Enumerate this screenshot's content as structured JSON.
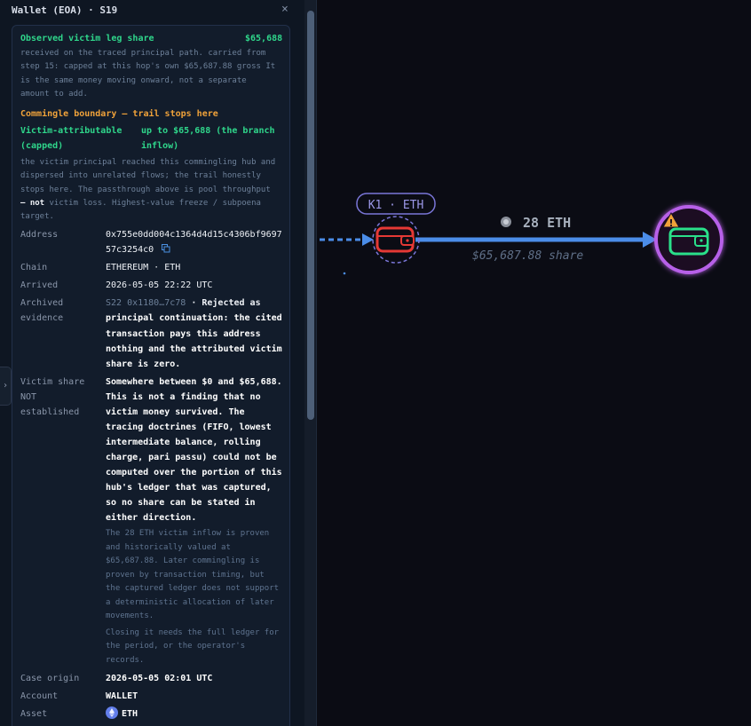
{
  "panel": {
    "title": "Wallet (EOA) · S19",
    "close_glyph": "×",
    "expand_glyph": "›"
  },
  "observed": {
    "label": "Observed victim leg share",
    "amount": "$65,688",
    "desc": [
      "received on the traced principal path. carried from",
      "step 15: capped at this hop's own $65,687.88 gross It",
      "is the same money moving onward, not a separate",
      "amount to add."
    ]
  },
  "commingle": {
    "heading": "Commingle boundary — trail stops here",
    "attr_label": [
      "Victim-attributable",
      "(capped)"
    ],
    "attr_value": [
      "up to $65,688 (the branch",
      "inflow)"
    ],
    "desc": [
      "the victim principal reached this commingling hub and",
      "dispersed into unrelated flows; the trail honestly",
      "stops here. The passthrough above is pool throughput"
    ],
    "desc_bold": "— not",
    "desc_rest": " victim loss. Highest-value freeze / subpoena",
    "desc_last": "target."
  },
  "fields": {
    "address_label": "Address",
    "address_lines": [
      "0x755e0dd004c1364d4d15c4306bf9697",
      "57c3254c0"
    ],
    "chain_label": "Chain",
    "chain_value": "ETHEREUM · ETH",
    "arrived_label": "Arrived",
    "arrived_value": "2026-05-05 22:22 UTC",
    "archived_label": [
      "Archived",
      "evidence"
    ],
    "archived_ref": "S22 0x1180…7c78",
    "archived_lines": [
      " · Rejected as",
      "principal continuation: the cited",
      "transaction pays this address",
      "nothing and the attributed victim",
      "share is zero."
    ],
    "victim_label": [
      "Victim share",
      "NOT",
      "established"
    ],
    "victim_line1": "Somewhere between $0 and $65,688.",
    "victim_bold": [
      "This is not a finding that no",
      "victim money survived."
    ],
    "victim_line3_rest": " The",
    "victim_lines": [
      "tracing doctrines (FIFO, lowest",
      "intermediate balance, rolling",
      "charge, pari passu) could not be",
      "computed over the portion of this",
      "hub's ledger that was captured,",
      "so no share can be stated in",
      "either direction."
    ],
    "victim_note1": [
      "The 28 ETH victim inflow is proven",
      "and historically valued at",
      "$65,687.88. Later commingling is",
      "proven by transaction timing, but",
      "the captured ledger does not support",
      "a deterministic allocation of later",
      "movements."
    ],
    "victim_note2": [
      "Closing it needs the full ledger for",
      "the period, or the operator's",
      "records."
    ],
    "case_label": "Case origin",
    "case_value": "2026-05-05 02:01 UTC",
    "account_label": "Account",
    "account_value": "WALLET",
    "asset_label": "Asset",
    "asset_value": "ETH"
  },
  "graph": {
    "node_badge": "K1 · ETH",
    "edge_amount": "28 ETH",
    "edge_share": "$65,687.88 share",
    "warning_glyph": "!"
  },
  "colors": {
    "accent_green": "#2fd68b",
    "accent_orange": "#f0a23a",
    "edge_blue": "#4b8de8",
    "node_red": "#e53935",
    "node_purple": "#b760e8"
  }
}
